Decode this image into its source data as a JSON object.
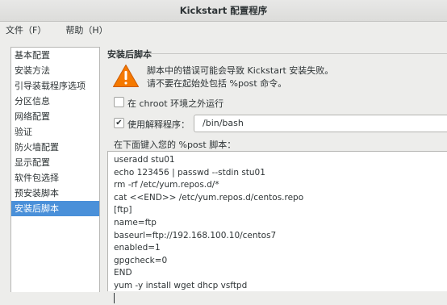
{
  "window": {
    "title": "Kickstart 配置程序"
  },
  "menubar": {
    "items": [
      "文件（F）",
      "帮助（H）"
    ]
  },
  "sidebar": {
    "items": [
      {
        "label": "基本配置",
        "active": false
      },
      {
        "label": "安装方法",
        "active": false
      },
      {
        "label": "引导装载程序选项",
        "active": false
      },
      {
        "label": "分区信息",
        "active": false
      },
      {
        "label": "网络配置",
        "active": false
      },
      {
        "label": "验证",
        "active": false
      },
      {
        "label": "防火墙配置",
        "active": false
      },
      {
        "label": "显示配置",
        "active": false
      },
      {
        "label": "软件包选择",
        "active": false
      },
      {
        "label": "预安装脚本",
        "active": false
      },
      {
        "label": "安装后脚本",
        "active": true
      }
    ]
  },
  "panel": {
    "title": "安装后脚本",
    "warning_icon": "warning-triangle-icon",
    "warning_text": "脚本中的错误可能会导致 Kickstart 安装失败。请不要在起始处包括 %post 命令。",
    "chroot_label": "在 chroot 环境之外运行",
    "chroot_checked": false,
    "interpreter_label": "使用解释程序：",
    "interpreter_checked": true,
    "interpreter_value": "/bin/bash",
    "script_label": "在下面键入您的 %post 脚本：",
    "script_lines": [
      "useradd stu01",
      "echo 123456 | passwd --stdin stu01",
      "rm -rf /etc/yum.repos.d/*",
      "cat <<END>> /etc/yum.repos.d/centos.repo",
      "[ftp]",
      "name=ftp",
      "baseurl=ftp://192.168.100.10/centos7",
      "enabled=1",
      "gpgcheck=0",
      "END",
      "yum -y install wget dhcp vsftpd"
    ]
  },
  "colors": {
    "selection": "#4a90d9",
    "warning": "#f57900"
  }
}
